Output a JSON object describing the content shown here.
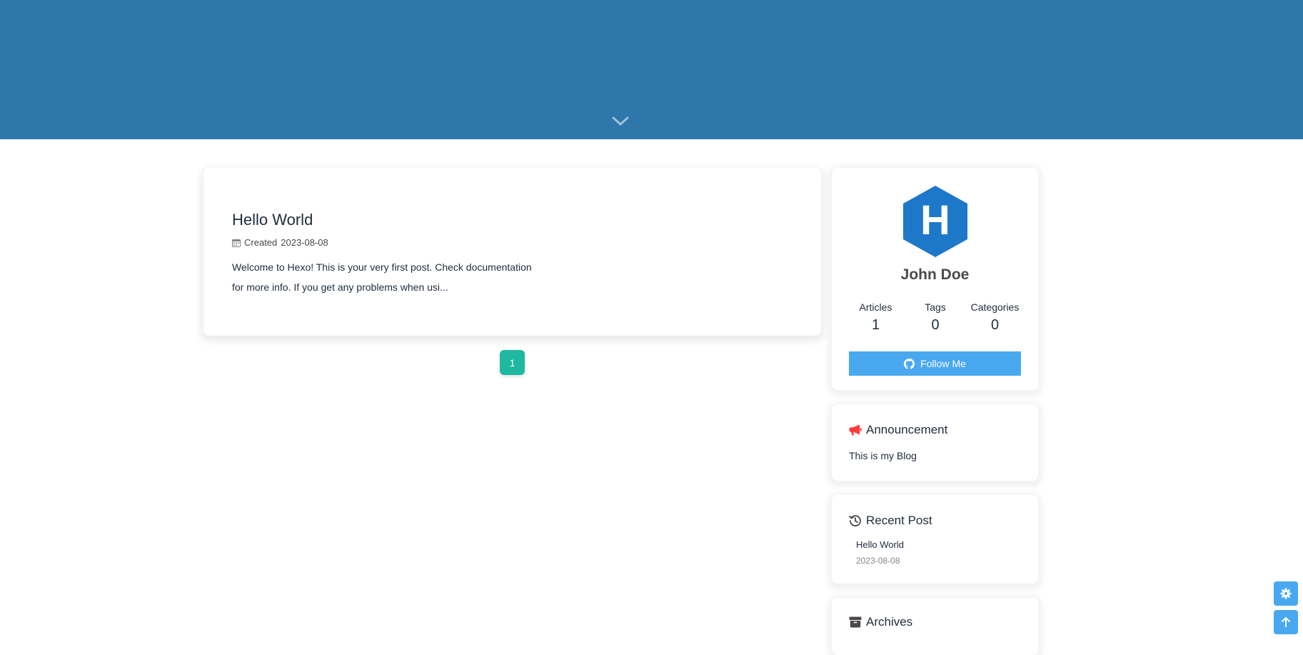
{
  "post": {
    "title": "Hello World",
    "meta_prefix": "Created",
    "date": "2023-08-08",
    "excerpt": "Welcome to Hexo! This is your very first post. Check documentation for more info. If you get any problems when usi..."
  },
  "pagination": {
    "current": "1"
  },
  "author": {
    "name": "John Doe",
    "avatar_letter": "H",
    "avatar_color": "#1e78c9",
    "stats": [
      {
        "label": "Articles",
        "value": "1"
      },
      {
        "label": "Tags",
        "value": "0"
      },
      {
        "label": "Categories",
        "value": "0"
      }
    ],
    "follow_label": "Follow Me"
  },
  "announcement": {
    "title": "Announcement",
    "text": "This is my Blog",
    "icon": "bullhorn-icon"
  },
  "recent": {
    "title": "Recent Post",
    "items": [
      {
        "title": "Hello World",
        "date": "2023-08-08"
      }
    ],
    "icon": "history-icon"
  },
  "archives": {
    "title": "Archives",
    "icon": "archive-icon"
  },
  "colors": {
    "banner": "#2f77ab",
    "accent": "#49a8f0",
    "page_active": "#1fb8a0",
    "announcement_icon": "#ff3b3b"
  }
}
